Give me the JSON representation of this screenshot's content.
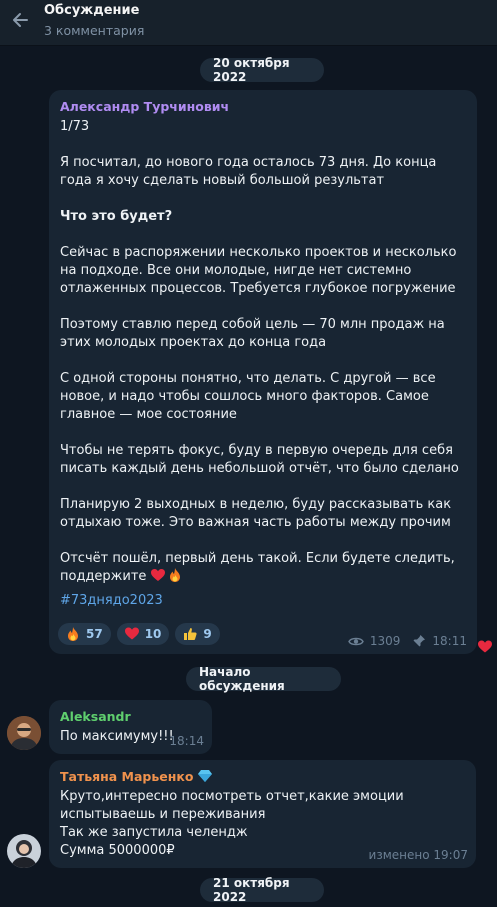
{
  "header": {
    "title": "Обсуждение",
    "subtitle": "3 комментария"
  },
  "dates": {
    "first": "20 октября 2022",
    "second": "21 октября 2022"
  },
  "discussion_start": "Начало обсуждения",
  "post": {
    "author": "Александр Турчинович",
    "author_color": "#b08cf2",
    "text": "1/73\n\nЯ посчитал, до нового года осталось 73 дня. До конца года я хочу сделать новый большой результат\n\n",
    "heading": "Что это будет?",
    "text2": "\n\nСейчас в распоряжении несколько проектов и несколько на подходе. Все они молодые, нигде нет системно отлаженных процессов. Требуется глубокое погружение\n\nПоэтому ставлю перед собой цель — 70 млн продаж на этих молодых проектах до конца года\n\nС одной стороны понятно, что делать. С другой — все новое, и надо чтобы сошлось много факторов. Самое главное — мое состояние\n\nЧтобы не терять фокус, буду в первую очередь для себя писать каждый день небольшой отчёт, что было сделано\n\nПланирую 2 выходных в неделю, буду рассказывать как отдыхаю тоже. Это важная часть работы между прочим\n\nОтсчёт пошёл, первый день такой. Если будете следить, поддержите",
    "hashtag": "#73днядо2023",
    "reactions": [
      {
        "icon": "fire-icon",
        "count": "57"
      },
      {
        "icon": "heart-icon",
        "count": "10"
      },
      {
        "icon": "thumbs-up-icon",
        "count": "9"
      }
    ],
    "views": "1309",
    "time": "18:11"
  },
  "comments": [
    {
      "author": "Aleksandr",
      "author_color": "#5fcf6e",
      "text": "По максимуму!!!",
      "time": "18:14"
    },
    {
      "author": "Татьяна Марьенко",
      "author_color": "#f0924d",
      "text": "Круто,интересно посмотреть отчет,какие эмоции испытываешь и переживания\nТак же запустила челендж\nСумма 5000000₽",
      "edited": "изменено",
      "time": "19:07"
    }
  ],
  "colors": {
    "background": "#0e1621",
    "bubble": "#182533",
    "header": "#17212b",
    "link": "#5fa6e8"
  }
}
